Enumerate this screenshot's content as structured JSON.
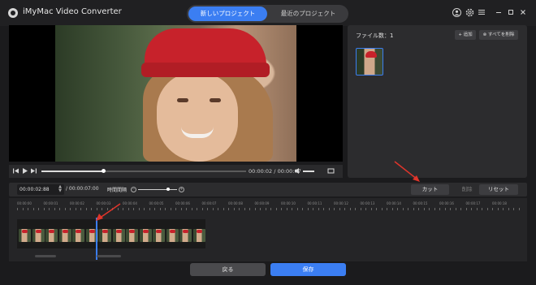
{
  "app": {
    "title": "iMyMac Video Converter"
  },
  "tabs": [
    {
      "label": "新しいプロジェクト",
      "active": true
    },
    {
      "label": "最近のプロジェクト",
      "active": false
    }
  ],
  "window_icons": [
    "user-icon",
    "settings-icon",
    "menu-icon",
    "minimize-icon",
    "maximize-icon",
    "close-icon"
  ],
  "player": {
    "current_time": "00:00:02",
    "total_time": "00:00:07",
    "time_separator": "/",
    "progress": 0.3
  },
  "files": {
    "count_label": "ファイル数：1",
    "add_label": "追加",
    "remove_all_label": "すべてを削除"
  },
  "cut": {
    "start_time": "00:00:02:88",
    "total_time": "/ 00:00:07:00",
    "interval_label": "時間間隔",
    "zoom_level": 0.78,
    "cut_label": "カット",
    "delete_label": "削除",
    "reset_label": "リセット"
  },
  "timeline": {
    "ruler_labels": [
      "00:00:00",
      "00:00:01",
      "00:00:02",
      "00:00:03",
      "00:00:04",
      "00:00:05",
      "00:00:06",
      "00:00:07",
      "00:00:08",
      "00:00:09",
      "00:00:10",
      "00:00:11",
      "00:00:12",
      "00:00:13",
      "00:00:14",
      "00:00:15",
      "00:00:16",
      "00:00:17",
      "00:00:18"
    ]
  },
  "actions": {
    "back_label": "戻る",
    "save_label": "保存"
  },
  "colors": {
    "accent": "#3b7ef2",
    "annotation": "#e0352b"
  }
}
